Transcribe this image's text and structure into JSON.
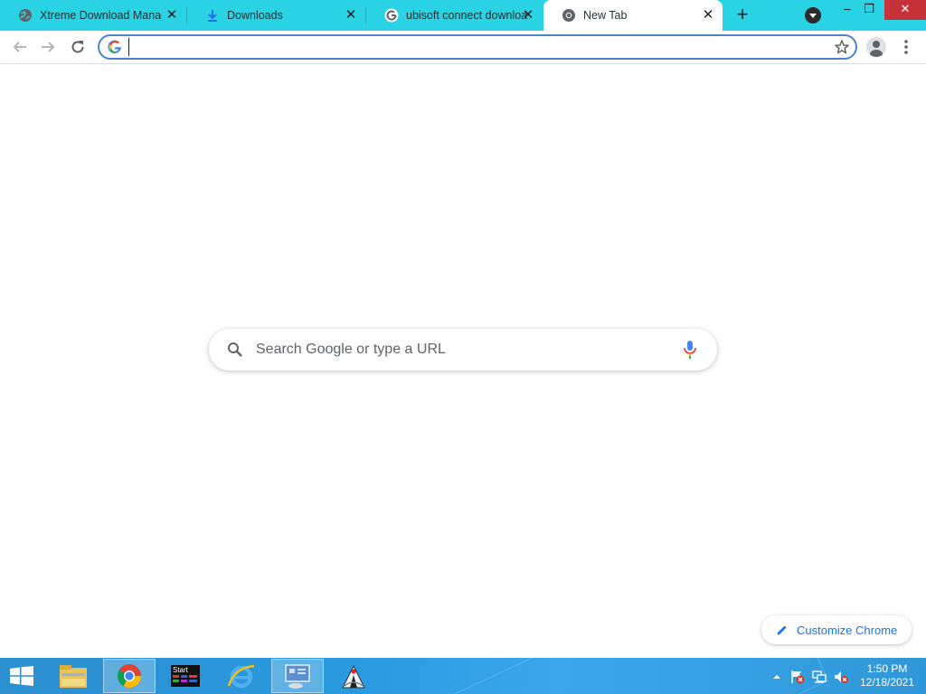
{
  "browser": {
    "tabs": [
      {
        "title": "Xtreme Download Manag",
        "icon": "globe-icon",
        "active": false
      },
      {
        "title": "Downloads",
        "icon": "download-icon",
        "active": false
      },
      {
        "title": "ubisoft connect downloa",
        "icon": "google-icon",
        "active": false
      },
      {
        "title": "New Tab",
        "icon": "chrome-icon",
        "active": true
      }
    ],
    "tab_close_glyph": "✕",
    "new_tab_glyph": "+",
    "window_controls": {
      "minimize": "–",
      "restore": "❐",
      "close": "✕"
    },
    "omnibox": {
      "value": "",
      "placeholder": ""
    },
    "colors": {
      "tabstrip": "#29d3e3",
      "omnibox_border": "#4d82c8",
      "accent": "#1a73e8"
    }
  },
  "newtab": {
    "search_placeholder": "Search Google or type a URL",
    "customize_label": "Customize Chrome"
  },
  "taskbar": {
    "apps": [
      "file-explorer-icon",
      "chrome-icon",
      "start-app-icon",
      "internet-explorer-icon",
      "control-panel-icon",
      "java-app-icon"
    ],
    "start_tile_label": "Start",
    "tray": [
      "show-hidden-icons-icon",
      "action-center-flag-icon",
      "network-icon",
      "volume-muted-icon"
    ],
    "clock_time": "1:50 PM",
    "clock_date": "12/18/2021"
  }
}
